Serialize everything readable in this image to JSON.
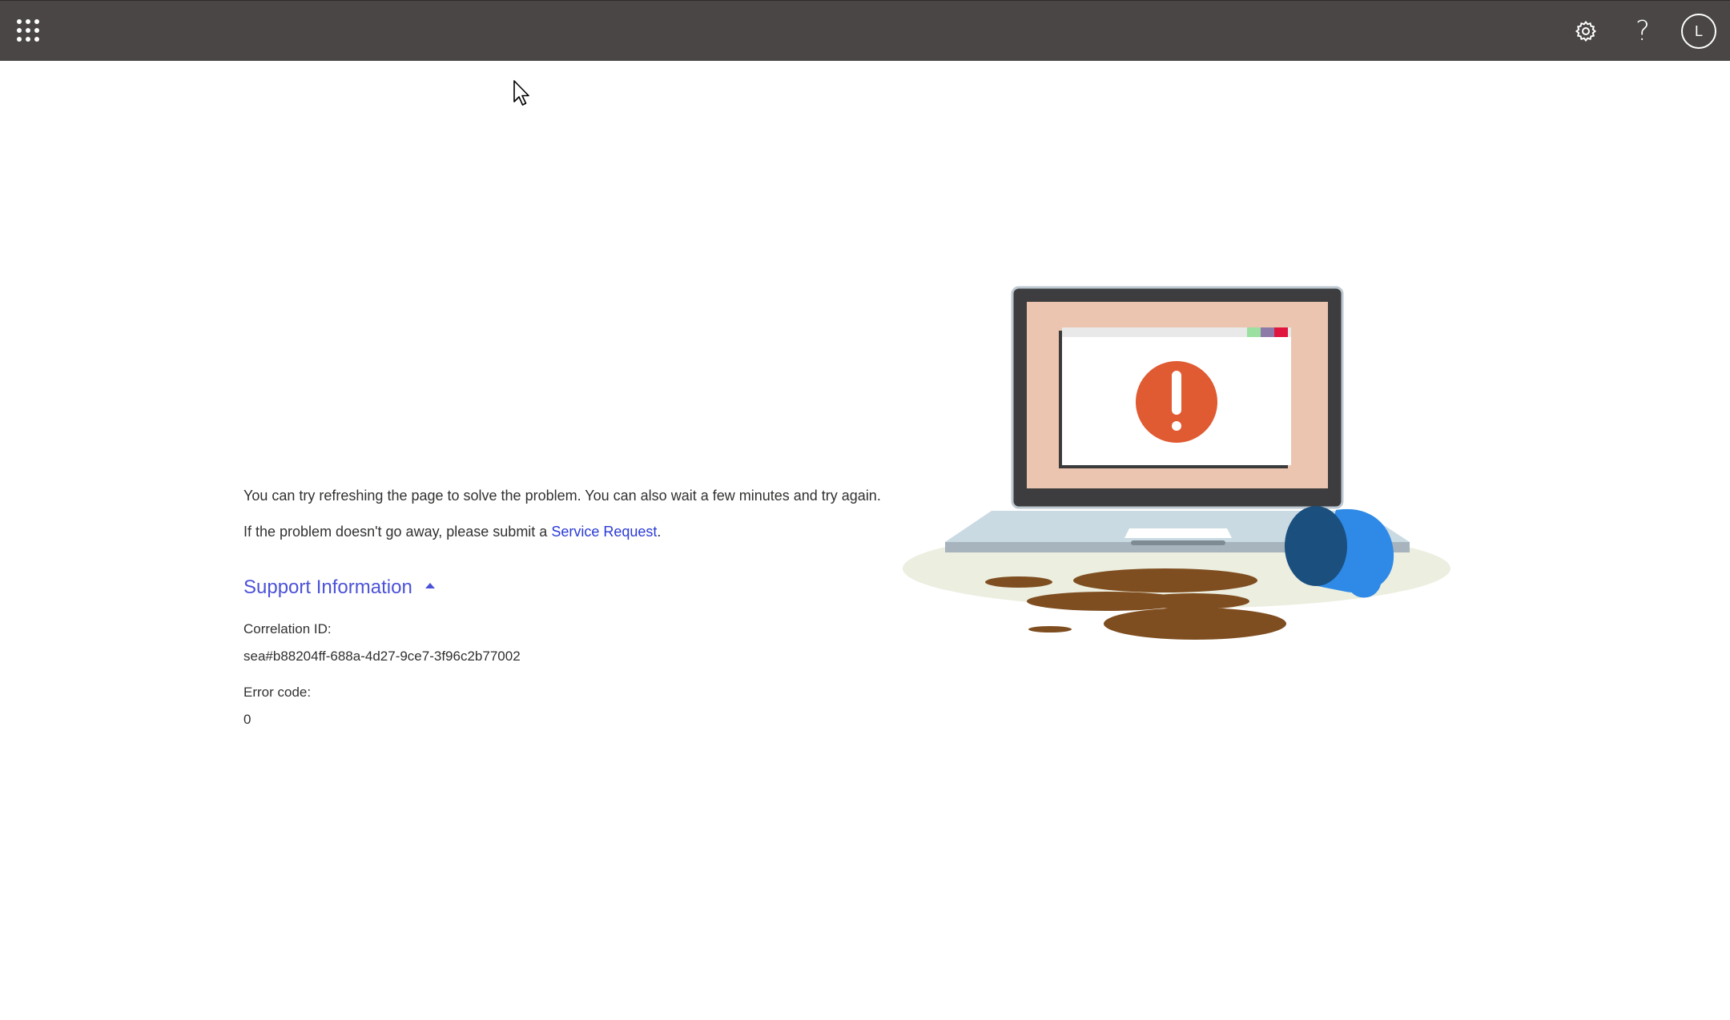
{
  "header": {
    "avatar_initial": "L",
    "background": "#494645",
    "icons": [
      "app-launcher-icon",
      "gear-icon",
      "question-mark-icon"
    ]
  },
  "main": {
    "message_line1": "You can try refreshing the page to solve the problem. You can also wait a few minutes and try again.",
    "message_line2_prefix": "If the problem doesn't go away, please submit a ",
    "service_request_link": "Service Request",
    "message_line2_suffix": ".",
    "support_toggle_label": "Support Information",
    "correlation_label": "Correlation ID:",
    "correlation_value": "sea#b88204ff-688a-4d27-9ce7-3f96c2b77002",
    "error_code_label": "Error code:",
    "error_code_value": "0"
  },
  "colors": {
    "link": "#2a3ad6",
    "alert": "#e05a32",
    "coffee": "#7f4e20",
    "mug": "#2e8ae6"
  }
}
